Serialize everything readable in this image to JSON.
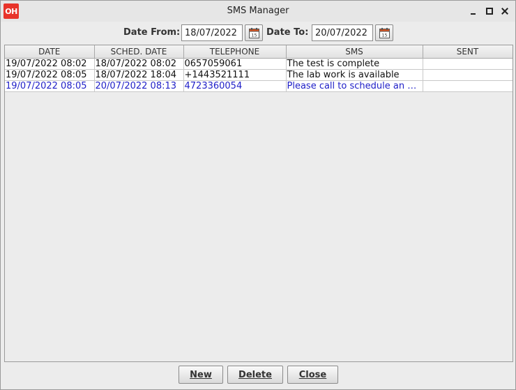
{
  "window": {
    "app_icon_text": "OH",
    "title": "SMS Manager"
  },
  "filters": {
    "date_from_label": "Date From:",
    "date_from_value": "18/07/2022",
    "date_to_label": "Date To:",
    "date_to_value": "20/07/2022",
    "calendar_icon": "calendar-icon"
  },
  "table": {
    "columns": [
      "DATE",
      "SCHED. DATE",
      "TELEPHONE",
      "SMS",
      "SENT"
    ],
    "rows": [
      {
        "date": "19/07/2022 08:02",
        "sched_date": "18/07/2022 08:02",
        "telephone": "0657059061",
        "sms": "The test is complete",
        "sent": ""
      },
      {
        "date": "19/07/2022 08:05",
        "sched_date": "18/07/2022 18:04",
        "telephone": "+1443521111",
        "sms": "The lab work is available",
        "sent": ""
      },
      {
        "date": "19/07/2022 08:05",
        "sched_date": "20/07/2022 08:13",
        "telephone": "4723360054",
        "sms": "Please call to schedule an a...",
        "sent": ""
      }
    ],
    "selected_row_color": "#2020c8"
  },
  "buttons": {
    "new": "New",
    "delete": "Delete",
    "close": "Close"
  },
  "colors": {
    "app_icon_bg": "#e8332a",
    "window_bg": "#ececec"
  }
}
